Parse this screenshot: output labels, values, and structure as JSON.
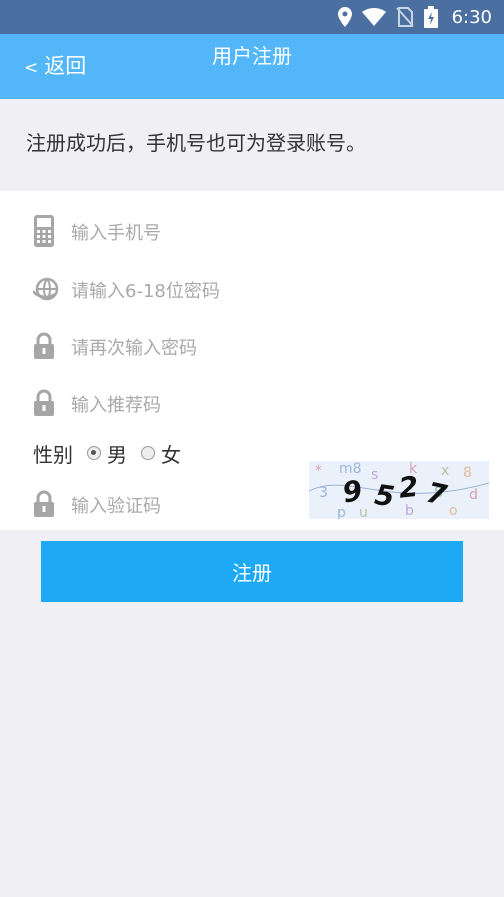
{
  "status_bar": {
    "time": "6:30"
  },
  "header": {
    "back_label": "返回",
    "back_chevron": "<",
    "title": "用户注册"
  },
  "hint": "注册成功后，手机号也可为登录账号。",
  "form": {
    "phone_placeholder": "输入手机号",
    "password_placeholder": "请输入6-18位密码",
    "confirm_placeholder": "请再次输入密码",
    "referral_placeholder": "输入推荐码",
    "gender_label": "性别",
    "gender_options": [
      "男",
      "女"
    ],
    "gender_selected": "男",
    "captcha_placeholder": "输入验证码",
    "captcha_code": "9527"
  },
  "submit_label": "注册",
  "colors": {
    "header": "#52b6f8",
    "status_bar": "#4a6fa0",
    "button": "#1ea9f6"
  },
  "icons": [
    "location-icon",
    "wifi-icon",
    "no-sim-icon",
    "battery-charging-icon",
    "phone-icon",
    "globe-icon",
    "lock-icon"
  ]
}
